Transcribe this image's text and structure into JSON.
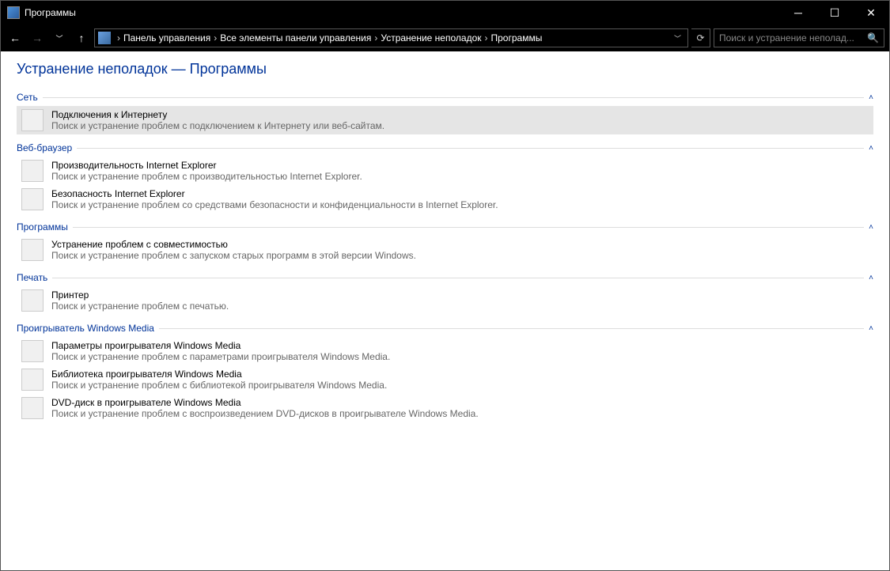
{
  "window": {
    "title": "Программы"
  },
  "breadcrumb": {
    "items": [
      "Панель управления",
      "Все элементы панели управления",
      "Устранение неполадок",
      "Программы"
    ]
  },
  "search": {
    "placeholder": "Поиск и устранение неполад..."
  },
  "page": {
    "title": "Устранение неполадок — Программы"
  },
  "sections": {
    "network": {
      "label": "Сеть",
      "items": [
        {
          "title": "Подключения к Интернету",
          "desc": "Поиск и устранение проблем с подключением к Интернету или веб-сайтам."
        }
      ]
    },
    "browser": {
      "label": "Веб-браузер",
      "items": [
        {
          "title": "Производительность Internet Explorer",
          "desc": "Поиск и устранение проблем с производительностью Internet Explorer."
        },
        {
          "title": "Безопасность Internet Explorer",
          "desc": "Поиск и устранение проблем со средствами безопасности и конфиденциальности в Internet Explorer."
        }
      ]
    },
    "programs": {
      "label": "Программы",
      "items": [
        {
          "title": "Устранение проблем с совместимостью",
          "desc": "Поиск и устранение проблем с запуском старых программ в этой версии Windows."
        }
      ]
    },
    "print": {
      "label": "Печать",
      "items": [
        {
          "title": "Принтер",
          "desc": "Поиск и устранение проблем с печатью."
        }
      ]
    },
    "wmp": {
      "label": "Проигрыватель Windows Media",
      "items": [
        {
          "title": "Параметры проигрывателя Windows Media",
          "desc": "Поиск и устранение проблем с параметрами проигрывателя Windows Media."
        },
        {
          "title": "Библиотека проигрывателя Windows Media",
          "desc": "Поиск и устранение проблем с библиотекой проигрывателя Windows Media."
        },
        {
          "title": "DVD-диск в проигрывателе Windows Media",
          "desc": "Поиск и устранение проблем с воспроизведением DVD-дисков в проигрывателе Windows Media."
        }
      ]
    }
  }
}
